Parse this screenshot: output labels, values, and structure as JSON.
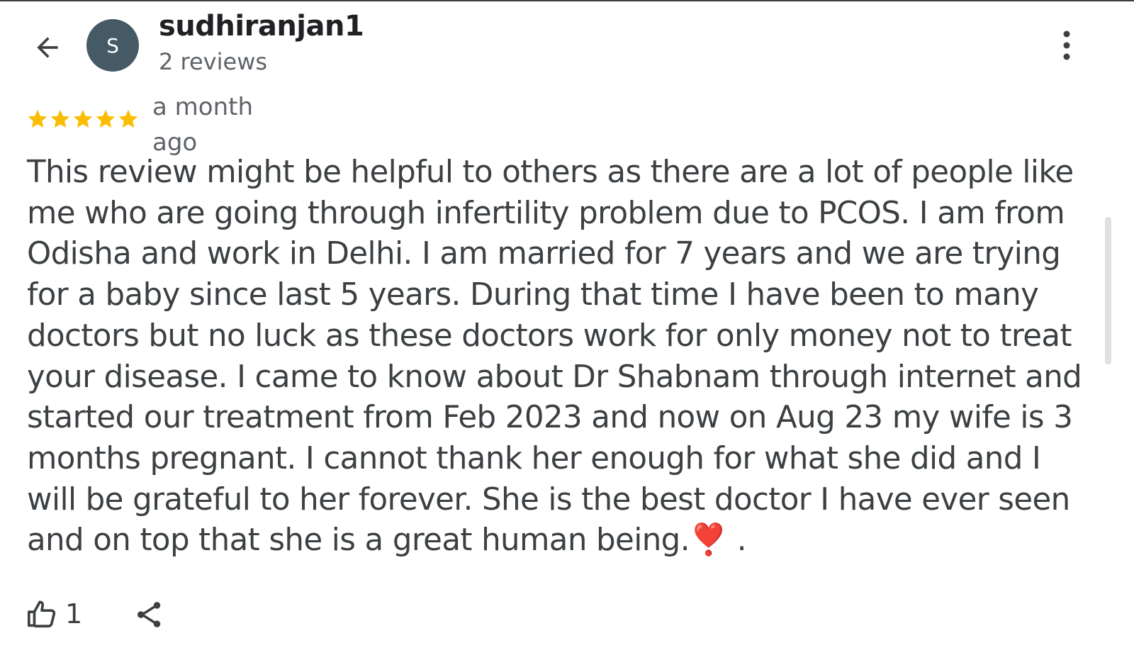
{
  "header": {
    "back_icon": "arrow-left-icon",
    "avatar_initial": "S",
    "avatar_color": "#455a64",
    "username": "sudhiranjan1",
    "review_count": "2 reviews",
    "more_icon": "more-vertical-icon"
  },
  "review": {
    "rating": 5,
    "max_rating": 5,
    "star_color": "#fbbc04",
    "time_ago": "a month ago",
    "text": "This review might be helpful to others as there are a lot of people like me who are going through infertility problem due to PCOS. I am from Odisha and work in Delhi. I am married for 7 years and we are trying for a baby since last 5 years. During that time I have been to many doctors but no luck as these doctors work for only money not to treat your disease. I came to know about Dr Shabnam through internet and started our treatment from Feb 2023 and now on Aug 23 my wife is 3 months pregnant. I cannot thank her enough for what she did and I will be grateful to her forever. She is the best doctor I have ever seen and on top that she is a great human being.",
    "emoji": "❣️",
    "trailing": " ."
  },
  "actions": {
    "like_icon": "thumbs-up-icon",
    "like_count": "1",
    "share_icon": "share-icon"
  }
}
